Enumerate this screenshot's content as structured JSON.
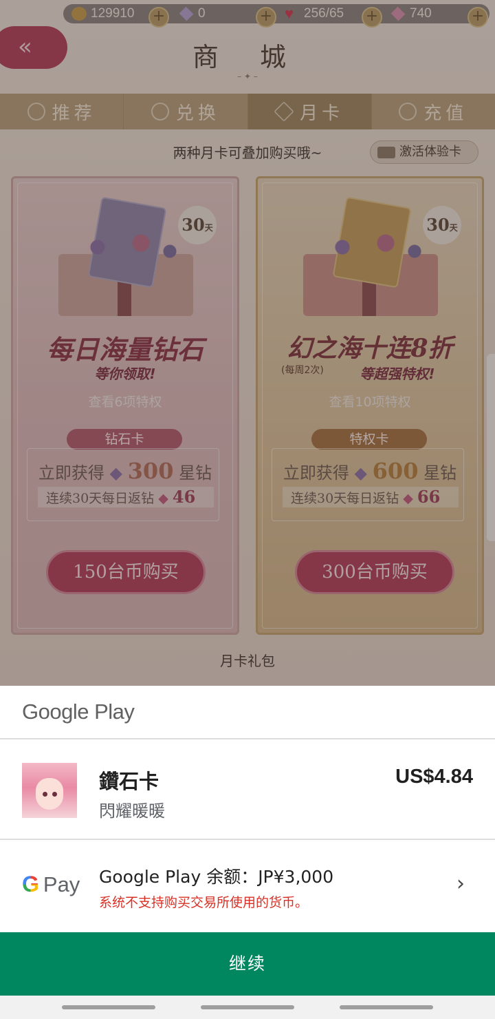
{
  "game": {
    "resources": [
      {
        "icon": "cat-coin-icon",
        "value": "129910"
      },
      {
        "icon": "gem-icon",
        "value": "0"
      },
      {
        "icon": "heart-icon",
        "value": "256/65"
      },
      {
        "icon": "star-diamond-icon",
        "value": "740"
      }
    ],
    "title": "商 城",
    "tabs": [
      {
        "label": "推荐",
        "icon": "recommend-icon",
        "active": false
      },
      {
        "label": "兑换",
        "icon": "exchange-icon",
        "active": false
      },
      {
        "label": "月卡",
        "icon": "diamond-icon",
        "active": true
      },
      {
        "label": "充值",
        "icon": "clock-icon",
        "active": false
      }
    ],
    "hint": "两种月卡可叠加购买哦~",
    "trial_button": "激活体验卡",
    "cards": [
      {
        "days": "30",
        "days_unit": "天",
        "slogan": "每日海量钻石",
        "sub_slogan": "等你领取!",
        "weekly_note": "",
        "privilege": "查看6项特权",
        "type": "钻石卡",
        "reward_prefix": "立即获得",
        "reward_amount": "300",
        "reward_unit": "星钻",
        "daily_prefix": "连续30天每日返钻",
        "daily_amount": "46",
        "buy": "150台币购买"
      },
      {
        "days": "30",
        "days_unit": "天",
        "slogan": "幻之海十连8折",
        "sub_slogan": "等超强特权!",
        "weekly_note": "(每周2次)",
        "privilege": "查看10项特权",
        "type": "特权卡",
        "reward_prefix": "立即获得",
        "reward_amount": "600",
        "reward_unit": "星钻",
        "daily_prefix": "连续30天每日返钻",
        "daily_amount": "66",
        "buy": "300台币购买"
      }
    ],
    "package_label": "月卡礼包"
  },
  "sheet": {
    "brand": "Google Play",
    "item": {
      "name": "鑽石卡",
      "app": "閃耀暖暖",
      "price": "US$4.84",
      "thumbnail_icon": "game-avatar-icon"
    },
    "payment": {
      "method": "Pay",
      "method_icon": "google-g-icon",
      "balance": "Google Play 余额：JP¥3,000",
      "error": "系统不支持购买交易所使用的货币。"
    },
    "continue_label": "继续"
  },
  "colors": {
    "continue_green": "#01875f",
    "error_red": "#d93025",
    "game_accent": "#b23a57"
  }
}
